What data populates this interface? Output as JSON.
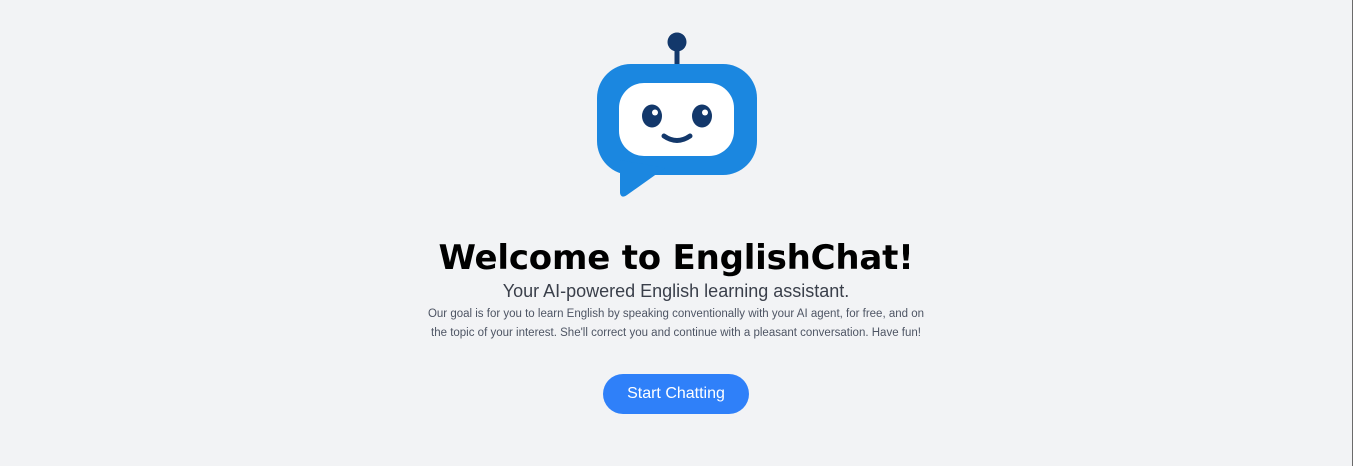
{
  "hero": {
    "logo_icon": "robot-chat-bubble-icon",
    "title": "Welcome to EnglishChat!",
    "subtitle": "Your AI-powered English learning assistant.",
    "description": "Our goal is for you to learn English by speaking conventionally with your AI agent, for free, and on the topic of your interest. She'll correct you and continue with a pleasant conversation. Have fun!",
    "cta_label": "Start Chatting"
  },
  "colors": {
    "background": "#f2f3f5",
    "accent": "#2f80f9",
    "bubble": "#1b87e0",
    "robot_dark": "#13386b"
  }
}
